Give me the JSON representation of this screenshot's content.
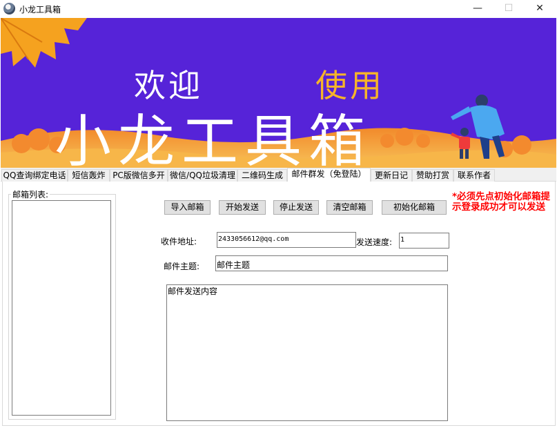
{
  "window": {
    "title": "小龙工具箱",
    "minimize": "—",
    "maximize": "☐",
    "close": "✕"
  },
  "banner": {
    "welcome": "欢迎",
    "use": "使用",
    "big_title": "小龙工具箱"
  },
  "tabs": [
    {
      "label": "QQ查询绑定电话",
      "active": false
    },
    {
      "label": "短信轰炸",
      "active": false
    },
    {
      "label": "PC版微信多开",
      "active": false
    },
    {
      "label": "微信/QQ垃圾清理",
      "active": false
    },
    {
      "label": "二维码生成",
      "active": false
    },
    {
      "label": "邮件群发（免登陆）",
      "active": true
    },
    {
      "label": "更新日记",
      "active": false
    },
    {
      "label": "赞助打赏",
      "active": false
    },
    {
      "label": "联系作者",
      "active": false
    }
  ],
  "mail": {
    "list_label": "邮箱列表:",
    "buttons": {
      "import": "导入邮箱",
      "start": "开始发送",
      "stop": "停止发送",
      "clear": "清空邮箱",
      "init": "初始化邮箱"
    },
    "warning": "*必须先点初始化邮箱提示登录成功才可以发送",
    "recipient_label": "收件地址:",
    "recipient_value": "2433056612@qq.com",
    "speed_label": "发送速度:",
    "speed_value": "1",
    "subject_label": "邮件主题:",
    "subject_value": "邮件主题",
    "body_value": "邮件发送内容"
  },
  "colors": {
    "banner_bg": "#5623d8",
    "accent_text": "#f6b42a",
    "warning": "#ff0000"
  },
  "icons": {
    "app": "app-logo-icon"
  }
}
